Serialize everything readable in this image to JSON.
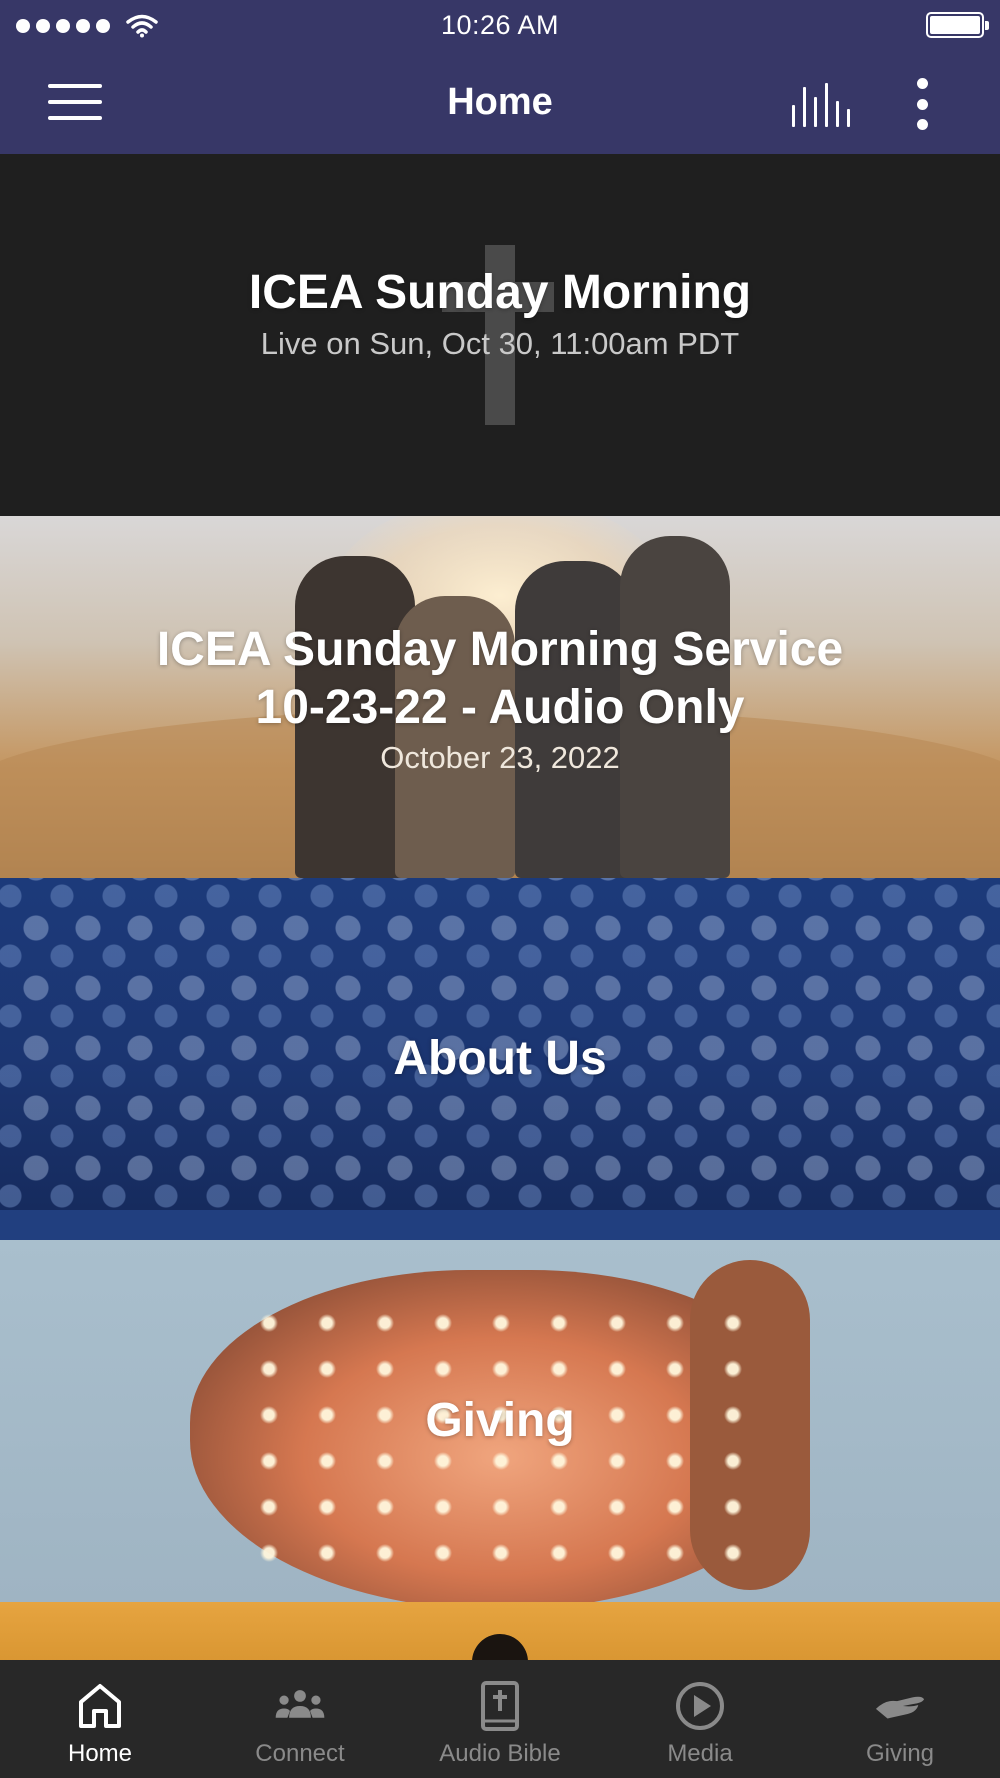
{
  "status_bar": {
    "time": "10:26 AM",
    "signal_dots": 5,
    "icons": [
      "signal-dots",
      "wifi-icon",
      "battery-icon"
    ]
  },
  "app_bar": {
    "title": "Home",
    "icons": [
      "hamburger-menu-icon",
      "audio-bars-icon",
      "more-vertical-icon"
    ]
  },
  "cards": [
    {
      "title": "ICEA Sunday Morning",
      "subtitle": "Live on Sun, Oct 30, 11:00am PDT",
      "icon": "cross-icon"
    },
    {
      "title": "ICEA Sunday Morning Service 10-23-22 - Audio Only",
      "subtitle": "October 23, 2022"
    },
    {
      "title": "About Us"
    },
    {
      "title": "Giving"
    }
  ],
  "tab_bar": {
    "tabs": [
      {
        "label": "Home",
        "icon": "home-icon",
        "active": true
      },
      {
        "label": "Connect",
        "icon": "people-group-icon",
        "active": false
      },
      {
        "label": "Audio Bible",
        "icon": "bible-icon",
        "active": false
      },
      {
        "label": "Media",
        "icon": "play-circle-icon",
        "active": false
      },
      {
        "label": "Giving",
        "icon": "giving-hand-icon",
        "active": false
      }
    ]
  },
  "colors": {
    "header": "#373767",
    "tab_bar": "#282828",
    "tab_active": "#ffffff",
    "tab_inactive": "#8a8a8a"
  }
}
